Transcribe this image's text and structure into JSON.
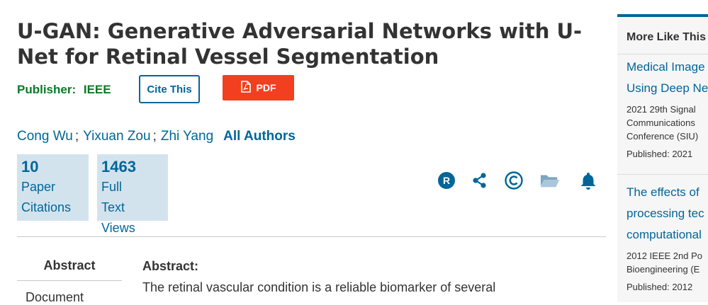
{
  "article": {
    "title": "U-GAN: Generative Adversarial Networks with U-Net for Retinal Vessel Segmentation",
    "publisher_label": "Publisher:",
    "publisher_name": "IEEE",
    "cite_label": "Cite This",
    "pdf_label": "PDF",
    "authors": [
      "Cong Wu",
      "Yixuan Zou",
      "Zhi Yang"
    ],
    "author_sep": ";",
    "all_authors_label": "All Authors"
  },
  "metrics": {
    "citations": {
      "value": "10",
      "label_1": "Paper",
      "label_2": "Citations"
    },
    "views": {
      "value": "1463",
      "label_1": "Full",
      "label_2": "Text",
      "label_3": "Views"
    }
  },
  "tools": {
    "icons": [
      "rights-icon",
      "share-icon",
      "copyright-icon",
      "folder-icon",
      "bell-icon"
    ],
    "color": "#006699"
  },
  "tabs": {
    "abstract": "Abstract",
    "document": "Document"
  },
  "abstract": {
    "heading": "Abstract:",
    "text": "The retinal vascular condition is a reliable biomarker of several"
  },
  "sidebar": {
    "heading": "More Like This",
    "items": [
      {
        "title_lines": [
          "Medical Image",
          "Using Deep Ne"
        ],
        "meta_lines": [
          "2021 29th Signal",
          "Communications",
          "Conference (SIU)"
        ],
        "published": "Published: 2021"
      },
      {
        "title_lines": [
          "The effects of",
          "processing tec",
          "computational"
        ],
        "meta_lines": [
          "2012 IEEE 2nd Po",
          "Bioengineering (E"
        ],
        "published": "Published: 2012"
      }
    ]
  },
  "colors": {
    "link": "#006699",
    "publisher": "#0a7a25",
    "pdf": "#f23f1f",
    "metric_bg": "#d3e3ee"
  }
}
